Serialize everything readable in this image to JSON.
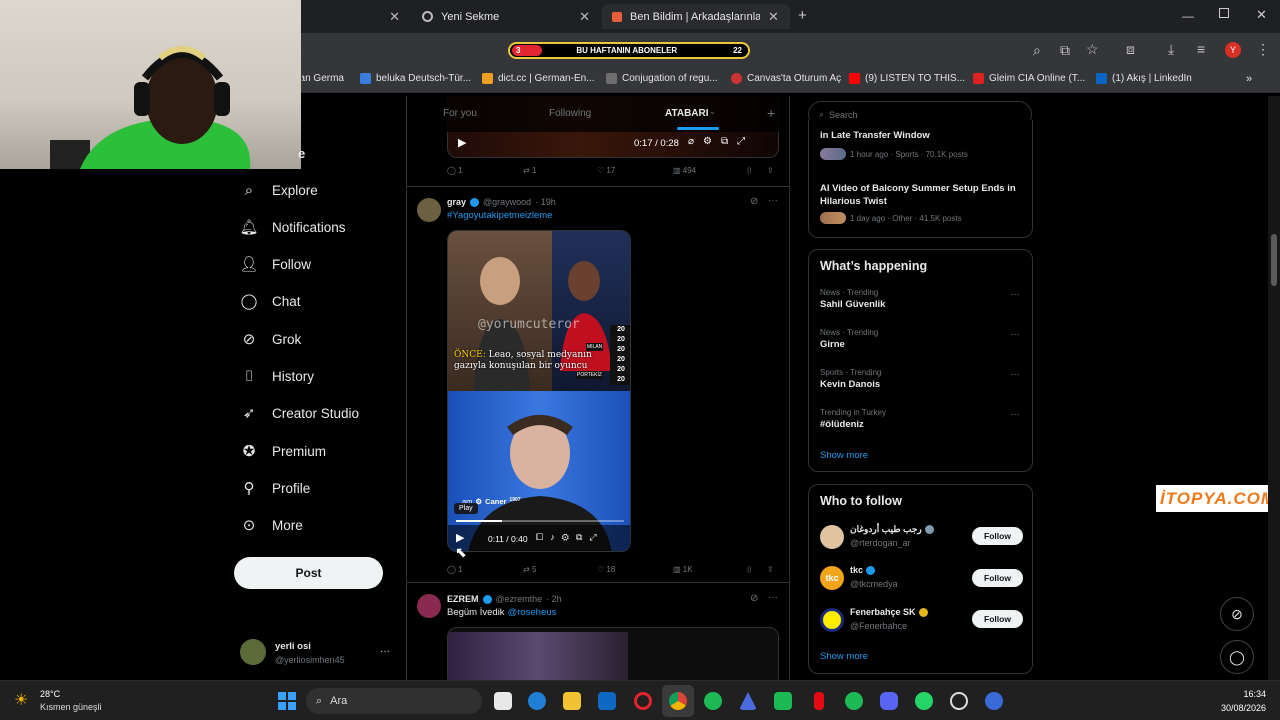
{
  "browser": {
    "tabs": [
      {
        "label": "Yeni Sekme"
      },
      {
        "label": "Ben Bildim | Arkadaşlarınla Onli"
      }
    ],
    "subscriber_bar": {
      "left": "3",
      "label": "BU HAFTANIN ABONELER",
      "right": "22"
    },
    "bookmarks": [
      "German Germa...",
      "beluka Deutsch-Tür...",
      "dict.cc | German-En...",
      "Conjugation of regu...",
      "Canvas'ta Oturum Aç",
      "(9) LISTEN TO THIS...",
      "Gleim CIA Online (T...",
      "(1) Akış | LinkedIn"
    ],
    "profile_initial": "Y"
  },
  "sidebar": {
    "partial_label": "e",
    "items": [
      {
        "label": "Explore",
        "icon": "search-icon"
      },
      {
        "label": "Notifications",
        "icon": "bell-icon"
      },
      {
        "label": "Follow",
        "icon": "add-user-icon"
      },
      {
        "label": "Chat",
        "icon": "chat-icon"
      },
      {
        "label": "Grok",
        "icon": "grok-icon"
      },
      {
        "label": "History",
        "icon": "bookmark-icon"
      },
      {
        "label": "Creator Studio",
        "icon": "rocket-icon"
      },
      {
        "label": "Premium",
        "icon": "verified-icon"
      },
      {
        "label": "Profile",
        "icon": "person-icon"
      },
      {
        "label": "More",
        "icon": "more-icon"
      }
    ],
    "post_label": "Post",
    "account": {
      "name": "yerli osi",
      "handle": "@yerliosimhen45",
      "more": "···"
    }
  },
  "feed": {
    "tabs": [
      "For you",
      "Following",
      "ATABARI"
    ],
    "plus": "+",
    "tweet0": {
      "time": "0:17 / 0:28",
      "replies": "1",
      "retweets": "1",
      "likes": "17",
      "views": "494"
    },
    "tweet1": {
      "name": "gray",
      "handle": "@graywood",
      "time": "· 19h",
      "hashtag": "#Yagoyutakipetmeizleme",
      "watermark": "@yorumcuteror",
      "caption_hl": "ÖNCE:",
      "caption": "Leao, sosyal medyanın gazıyla konuşulan bir oyuncu",
      "years": [
        "20",
        "20",
        "20",
        "20",
        "20",
        "20"
      ],
      "milan": "MILAN",
      "portekiz": "PORTEKİZ",
      "overlay_name": "Caner",
      "overlay_num": "1907",
      "overlay_pre": "am",
      "tooltip": "Play",
      "video_time": "0:11 / 0:40",
      "replies": "1",
      "retweets": "5",
      "likes": "18",
      "views": "1K"
    },
    "tweet2": {
      "name": "EZREM",
      "handle": "@ezremthe",
      "time": "· 2h",
      "text": "Begüm İvedik",
      "mention": "@roseheus"
    }
  },
  "right": {
    "search_placeholder": "Search",
    "top_trends": [
      {
        "title": "in Late Transfer Window",
        "meta": "1 hour ago · Sports · 70.1K posts"
      },
      {
        "title": "AI Video of Balcony Summer Setup Ends in Hilarious Twist",
        "meta": "1 day ago · Other · 41.5K posts"
      }
    ],
    "happening_title": "What’s happening",
    "trends": [
      {
        "cat": "News · Trending",
        "name": "Sahil Güvenlik"
      },
      {
        "cat": "News · Trending",
        "name": "Girne"
      },
      {
        "cat": "Sports · Trending",
        "name": "Kevin Danois"
      },
      {
        "cat": "Trending in Turkey",
        "name": "#ölüdeniz"
      }
    ],
    "show_more": "Show more",
    "wtf_title": "Who to follow",
    "follow": [
      {
        "name": "رجب طيب أردوغان",
        "handle": "@rterdogan_ar",
        "color": "#e0c3a0"
      },
      {
        "name": "tkc",
        "handle": "@tkcmedya",
        "color": "#f2a51a"
      },
      {
        "name": "Fenerbahçe SK",
        "handle": "@Fenerbahce",
        "color": "#ffed00"
      }
    ],
    "follow_label": "Follow",
    "show_more2": "Show more"
  },
  "overlay": {
    "logo": "İTOPYA.COM"
  },
  "taskbar": {
    "weather_temp": "28°C",
    "weather_desc": "Kısmen güneşli",
    "search": "Ara",
    "time": "16:34",
    "date": "30/08/2026"
  }
}
